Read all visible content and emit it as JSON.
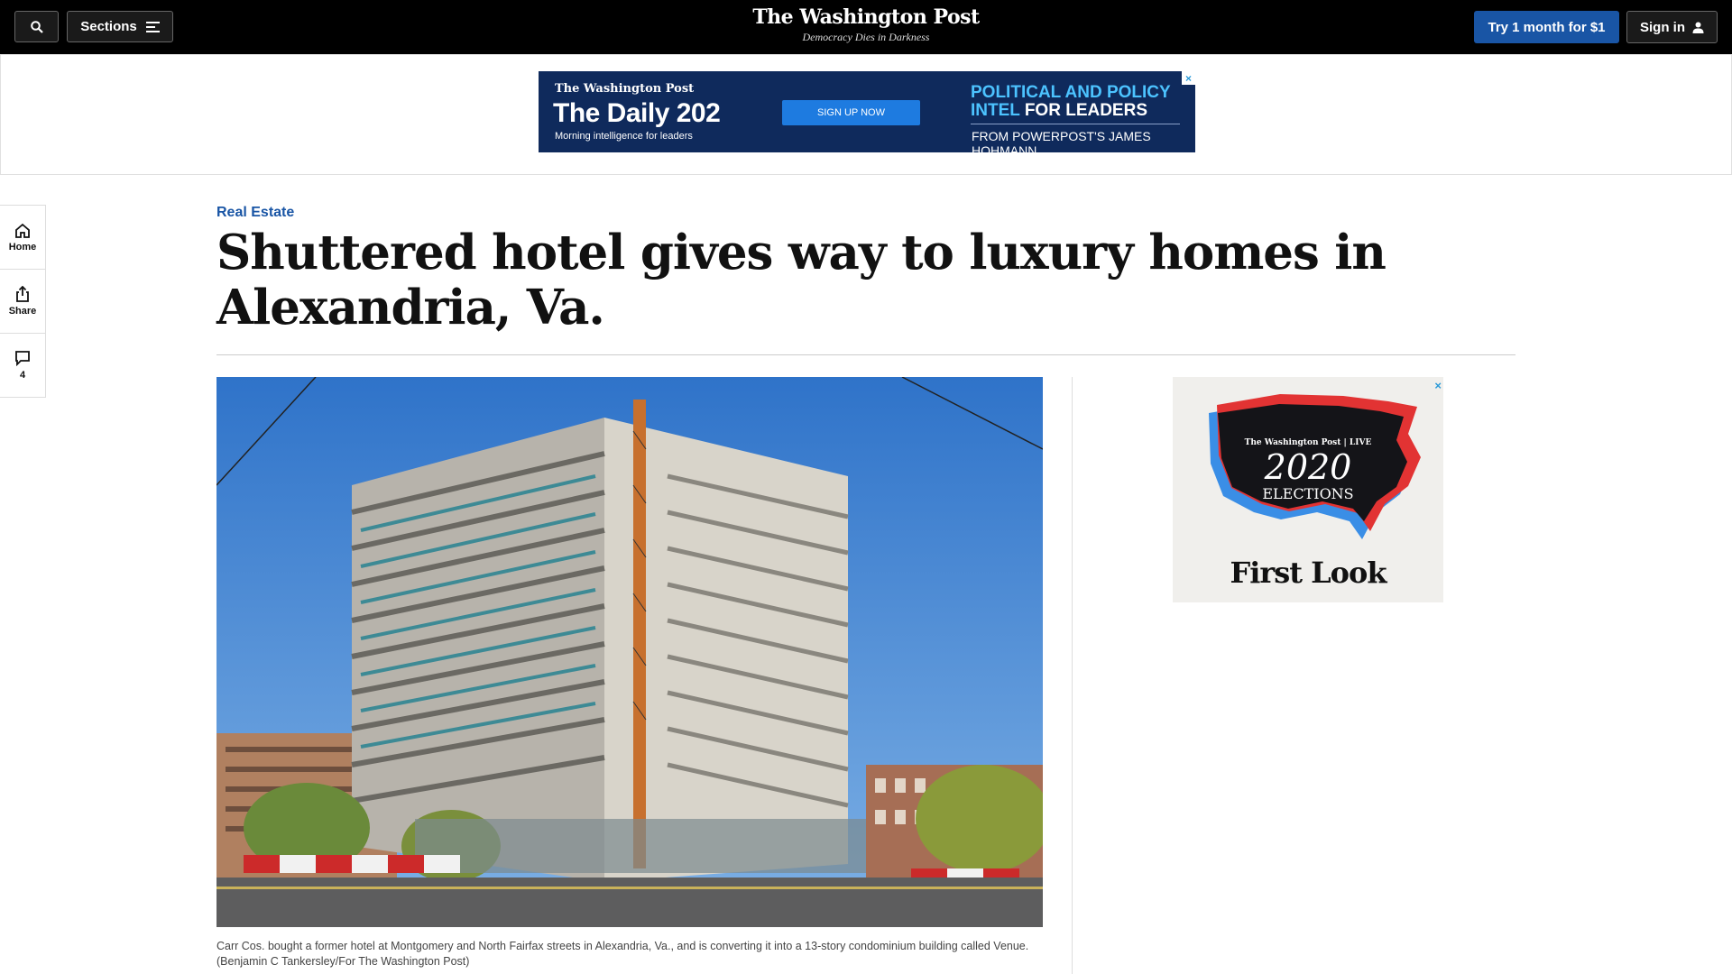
{
  "nav": {
    "sections_label": "Sections",
    "logo": "The Washington Post",
    "tagline": "Democracy Dies in Darkness",
    "try_label": "Try 1 month for $1",
    "signin_label": "Sign in"
  },
  "ad_top": {
    "brand": "The Washington Post",
    "title": "The Daily 202",
    "subtitle": "Morning intelligence for leaders",
    "cta": "SIGN UP NOW",
    "headline_line1": "POLITICAL AND POLICY",
    "headline_line2_accent": "INTEL",
    "headline_line2_rest": " FOR LEADERS",
    "byline": "FROM POWERPOST'S JAMES HOHMANN",
    "close": "×"
  },
  "rail": {
    "home_label": "Home",
    "share_label": "Share",
    "comments_count": "4"
  },
  "article": {
    "kicker": "Real Estate",
    "headline": "Shuttered hotel gives way to luxury homes in Alexandria, Va.",
    "caption": "Carr Cos. bought a former hotel at Montgomery and North Fairfax streets in Alexandria, Va., and is converting it into a 13-story condominium building called Venue. (Benjamin C Tankersley/For The Washington Post)"
  },
  "ad_side": {
    "brand": "The Washington Post | LIVE",
    "year": "2020",
    "label": "ELECTIONS",
    "title": "First Look",
    "close": "×"
  },
  "colors": {
    "nav_bg": "#000000",
    "accent_blue": "#1955a5",
    "kicker_blue": "#1955a5",
    "ad_navy": "#0f2a5c",
    "ad_cyan": "#4cc3ff"
  }
}
